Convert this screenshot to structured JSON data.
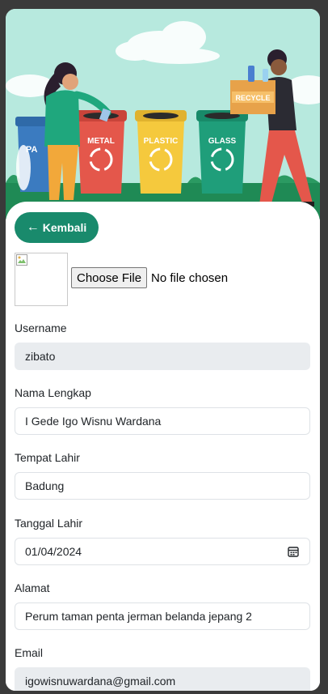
{
  "hero": {
    "bins": [
      {
        "label": "PAPER",
        "visible_text": "PA",
        "color": "#3b7bc0"
      },
      {
        "label": "METAL",
        "color": "#e4574b"
      },
      {
        "label": "PLASTIC",
        "color": "#f5c93d"
      },
      {
        "label": "GLASS",
        "color": "#1f9e7a"
      }
    ],
    "box_label": "RECYCLE"
  },
  "back_button": {
    "label": "Kembali",
    "icon": "arrow-left-icon"
  },
  "profile_image": {
    "icon": "broken-image-icon"
  },
  "file_input": {
    "button_label": "Choose File",
    "status": "No file chosen"
  },
  "form": {
    "username": {
      "label": "Username",
      "value": "zibato"
    },
    "full_name": {
      "label": "Nama Lengkap",
      "value": "I Gede Igo Wisnu Wardana"
    },
    "birth_place": {
      "label": "Tempat Lahir",
      "value": "Badung"
    },
    "birth_date": {
      "label": "Tanggal Lahir",
      "value": "01/04/2024",
      "icon": "calendar-icon"
    },
    "address": {
      "label": "Alamat",
      "value": "Perum taman penta jerman belanda jepang 2"
    },
    "email": {
      "label": "Email",
      "value": "igowisnuwardana@gmail.com"
    }
  },
  "colors": {
    "primary": "#198a6c",
    "hero_background": "#b7e9de",
    "readonly_field": "#e9ecef",
    "window_border": "#3a3a3a"
  }
}
